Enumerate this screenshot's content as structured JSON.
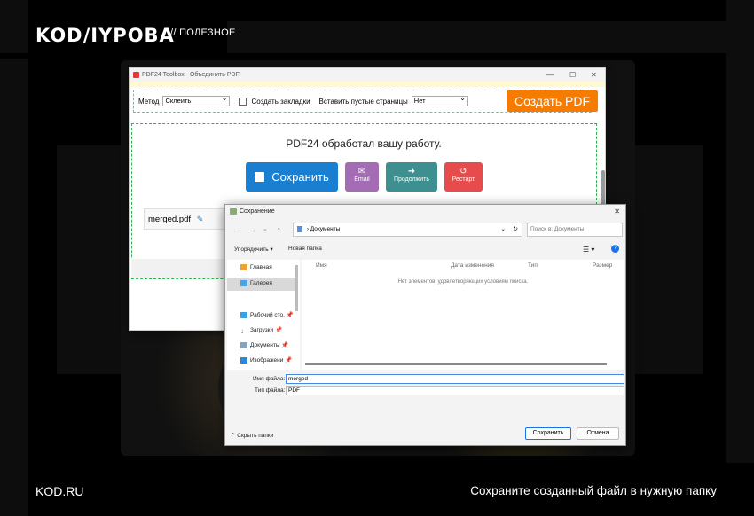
{
  "brand": {
    "logo": "KOD/IYPOBA",
    "section": "// ПОЛЕЗНОЕ",
    "site": "KOD.RU",
    "caption": "Сохраните созданный файл в нужную папку"
  },
  "pdf24": {
    "title": "PDF24 Toolbox - Объединить PDF",
    "method_label": "Метод",
    "method_value": "Склеить",
    "bookmarks_label": "Создать закладки",
    "blank_pages_label": "Вставить пустые страницы",
    "blank_pages_value": "Нет",
    "create_button": "Создать PDF",
    "done_text": "PDF24 обработал вашу работу.",
    "save_button": "Сохранить",
    "email_button": "Email",
    "continue_button": "Продолжить",
    "restart_button": "Рестарт",
    "file_name": "merged.pdf"
  },
  "dialog": {
    "title": "Сохранение",
    "address": "Документы",
    "search_placeholder": "Поиск в: Документы",
    "organize": "Упорядочить ▾",
    "new_folder": "Новая папка",
    "nav": [
      {
        "label": "Главная"
      },
      {
        "label": "Галерея"
      },
      {
        "label": "Рабочий сто."
      },
      {
        "label": "Загрузки"
      },
      {
        "label": "Документы"
      },
      {
        "label": "Изображени"
      }
    ],
    "columns": [
      "Имя",
      "Дата изменения",
      "Тип",
      "Размер"
    ],
    "empty_text": "Нет элементов, удовлетворяющих условиям поиска.",
    "filename_label": "Имя файла:",
    "filename_value": "merged",
    "filetype_label": "Тип файла:",
    "filetype_value": "PDF",
    "hide_folders": "Скрыть папки",
    "save_button": "Сохранить",
    "cancel_button": "Отмена"
  }
}
